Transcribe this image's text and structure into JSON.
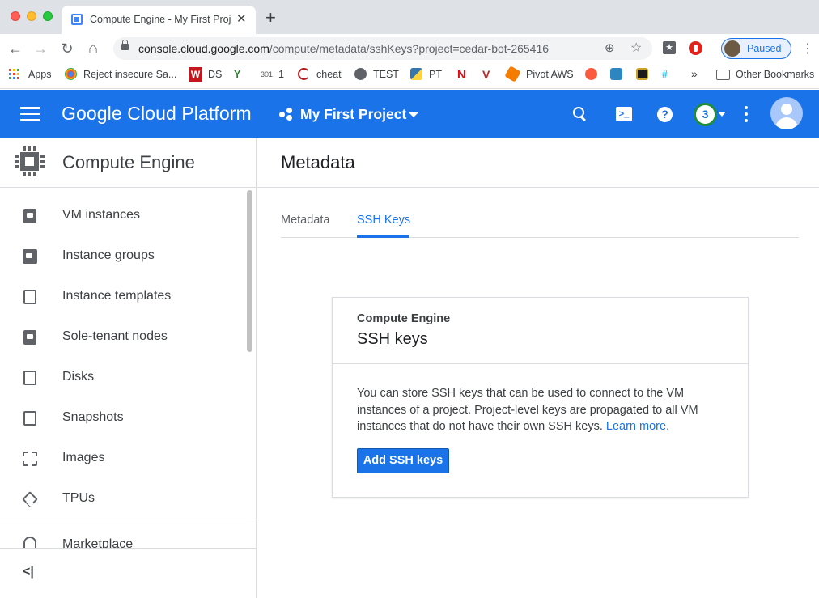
{
  "browser": {
    "tab_title": "Compute Engine - My First Proje",
    "tab_close": "✕",
    "new_tab": "+",
    "nav": {
      "back": "←",
      "forward": "→",
      "reload": "↻",
      "home": "⌂"
    },
    "url_host": "console.cloud.google.com",
    "url_path": "/compute/metadata/sshKeys?project=cedar-bot-265416",
    "profile_status": "Paused",
    "colors": {
      "tab_strip": "#dee1e6",
      "omnibox": "#f1f3f4",
      "profile_accent": "#1a73e8"
    }
  },
  "bookmarks": {
    "items": [
      {
        "label": "Apps",
        "icon": "apps-grid-icon"
      },
      {
        "label": "Reject insecure Sa...",
        "icon": "chrome-icon"
      },
      {
        "label": "DS",
        "icon": "w-logo-icon"
      },
      {
        "label": "",
        "icon": "sprout-icon"
      },
      {
        "label": "1",
        "icon": "301-icon",
        "prefix": "301"
      },
      {
        "label": "cheat",
        "icon": "crescent-icon"
      },
      {
        "label": "TEST",
        "icon": "globe-icon"
      },
      {
        "label": "PT",
        "icon": "python-icon"
      },
      {
        "label": "",
        "icon": "netflix-icon",
        "glyph": "N"
      },
      {
        "label": "",
        "icon": "v-logo-icon",
        "glyph": "V"
      },
      {
        "label": "Pivot AWS",
        "icon": "aws-icon"
      },
      {
        "label": "",
        "icon": "music-icon"
      },
      {
        "label": "",
        "icon": "plus-square-icon"
      },
      {
        "label": "",
        "icon": "badge-icon"
      },
      {
        "label": "",
        "icon": "slack-icon"
      }
    ],
    "overflow": "»",
    "other": "Other Bookmarks"
  },
  "gcp_header": {
    "title": "Google Cloud Platform",
    "project": "My First Project",
    "notifications": "3",
    "shell_glyph": ">_",
    "help_glyph": "?",
    "color": "#1a73e8"
  },
  "sidebar": {
    "title": "Compute Engine",
    "items": [
      {
        "label": "VM instances"
      },
      {
        "label": "Instance groups"
      },
      {
        "label": "Instance templates"
      },
      {
        "label": "Sole-tenant nodes"
      },
      {
        "label": "Disks"
      },
      {
        "label": "Snapshots"
      },
      {
        "label": "Images"
      },
      {
        "label": "TPUs"
      }
    ],
    "marketplace": "Marketplace",
    "collapse": "<|"
  },
  "main": {
    "page_title": "Metadata",
    "tabs": [
      {
        "label": "Metadata",
        "active": false
      },
      {
        "label": "SSH Keys",
        "active": true
      }
    ],
    "card": {
      "eyebrow": "Compute Engine",
      "title": "SSH keys",
      "body": "You can store SSH keys that can be used to connect to the VM instances of a project. Project-level keys are propagated to all VM instances that do not have their own SSH keys.",
      "link": "Learn more",
      "link_suffix": ".",
      "button": "Add SSH keys"
    }
  }
}
